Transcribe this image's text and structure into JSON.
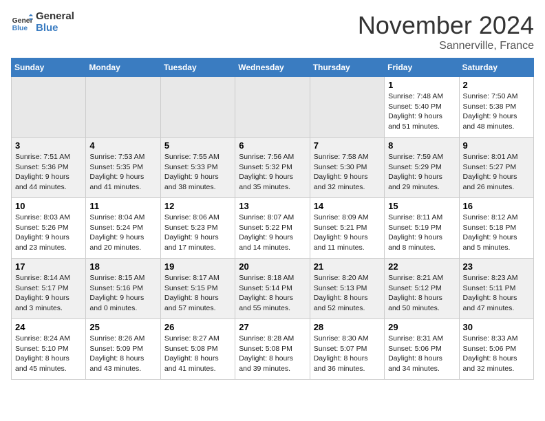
{
  "header": {
    "logo_line1": "General",
    "logo_line2": "Blue",
    "month_title": "November 2024",
    "location": "Sannerville, France"
  },
  "days_of_week": [
    "Sunday",
    "Monday",
    "Tuesday",
    "Wednesday",
    "Thursday",
    "Friday",
    "Saturday"
  ],
  "weeks": [
    [
      {
        "day": "",
        "info": ""
      },
      {
        "day": "",
        "info": ""
      },
      {
        "day": "",
        "info": ""
      },
      {
        "day": "",
        "info": ""
      },
      {
        "day": "",
        "info": ""
      },
      {
        "day": "1",
        "info": "Sunrise: 7:48 AM\nSunset: 5:40 PM\nDaylight: 9 hours\nand 51 minutes."
      },
      {
        "day": "2",
        "info": "Sunrise: 7:50 AM\nSunset: 5:38 PM\nDaylight: 9 hours\nand 48 minutes."
      }
    ],
    [
      {
        "day": "3",
        "info": "Sunrise: 7:51 AM\nSunset: 5:36 PM\nDaylight: 9 hours\nand 44 minutes."
      },
      {
        "day": "4",
        "info": "Sunrise: 7:53 AM\nSunset: 5:35 PM\nDaylight: 9 hours\nand 41 minutes."
      },
      {
        "day": "5",
        "info": "Sunrise: 7:55 AM\nSunset: 5:33 PM\nDaylight: 9 hours\nand 38 minutes."
      },
      {
        "day": "6",
        "info": "Sunrise: 7:56 AM\nSunset: 5:32 PM\nDaylight: 9 hours\nand 35 minutes."
      },
      {
        "day": "7",
        "info": "Sunrise: 7:58 AM\nSunset: 5:30 PM\nDaylight: 9 hours\nand 32 minutes."
      },
      {
        "day": "8",
        "info": "Sunrise: 7:59 AM\nSunset: 5:29 PM\nDaylight: 9 hours\nand 29 minutes."
      },
      {
        "day": "9",
        "info": "Sunrise: 8:01 AM\nSunset: 5:27 PM\nDaylight: 9 hours\nand 26 minutes."
      }
    ],
    [
      {
        "day": "10",
        "info": "Sunrise: 8:03 AM\nSunset: 5:26 PM\nDaylight: 9 hours\nand 23 minutes."
      },
      {
        "day": "11",
        "info": "Sunrise: 8:04 AM\nSunset: 5:24 PM\nDaylight: 9 hours\nand 20 minutes."
      },
      {
        "day": "12",
        "info": "Sunrise: 8:06 AM\nSunset: 5:23 PM\nDaylight: 9 hours\nand 17 minutes."
      },
      {
        "day": "13",
        "info": "Sunrise: 8:07 AM\nSunset: 5:22 PM\nDaylight: 9 hours\nand 14 minutes."
      },
      {
        "day": "14",
        "info": "Sunrise: 8:09 AM\nSunset: 5:21 PM\nDaylight: 9 hours\nand 11 minutes."
      },
      {
        "day": "15",
        "info": "Sunrise: 8:11 AM\nSunset: 5:19 PM\nDaylight: 9 hours\nand 8 minutes."
      },
      {
        "day": "16",
        "info": "Sunrise: 8:12 AM\nSunset: 5:18 PM\nDaylight: 9 hours\nand 5 minutes."
      }
    ],
    [
      {
        "day": "17",
        "info": "Sunrise: 8:14 AM\nSunset: 5:17 PM\nDaylight: 9 hours\nand 3 minutes."
      },
      {
        "day": "18",
        "info": "Sunrise: 8:15 AM\nSunset: 5:16 PM\nDaylight: 9 hours\nand 0 minutes."
      },
      {
        "day": "19",
        "info": "Sunrise: 8:17 AM\nSunset: 5:15 PM\nDaylight: 8 hours\nand 57 minutes."
      },
      {
        "day": "20",
        "info": "Sunrise: 8:18 AM\nSunset: 5:14 PM\nDaylight: 8 hours\nand 55 minutes."
      },
      {
        "day": "21",
        "info": "Sunrise: 8:20 AM\nSunset: 5:13 PM\nDaylight: 8 hours\nand 52 minutes."
      },
      {
        "day": "22",
        "info": "Sunrise: 8:21 AM\nSunset: 5:12 PM\nDaylight: 8 hours\nand 50 minutes."
      },
      {
        "day": "23",
        "info": "Sunrise: 8:23 AM\nSunset: 5:11 PM\nDaylight: 8 hours\nand 47 minutes."
      }
    ],
    [
      {
        "day": "24",
        "info": "Sunrise: 8:24 AM\nSunset: 5:10 PM\nDaylight: 8 hours\nand 45 minutes."
      },
      {
        "day": "25",
        "info": "Sunrise: 8:26 AM\nSunset: 5:09 PM\nDaylight: 8 hours\nand 43 minutes."
      },
      {
        "day": "26",
        "info": "Sunrise: 8:27 AM\nSunset: 5:08 PM\nDaylight: 8 hours\nand 41 minutes."
      },
      {
        "day": "27",
        "info": "Sunrise: 8:28 AM\nSunset: 5:08 PM\nDaylight: 8 hours\nand 39 minutes."
      },
      {
        "day": "28",
        "info": "Sunrise: 8:30 AM\nSunset: 5:07 PM\nDaylight: 8 hours\nand 36 minutes."
      },
      {
        "day": "29",
        "info": "Sunrise: 8:31 AM\nSunset: 5:06 PM\nDaylight: 8 hours\nand 34 minutes."
      },
      {
        "day": "30",
        "info": "Sunrise: 8:33 AM\nSunset: 5:06 PM\nDaylight: 8 hours\nand 32 minutes."
      }
    ]
  ]
}
